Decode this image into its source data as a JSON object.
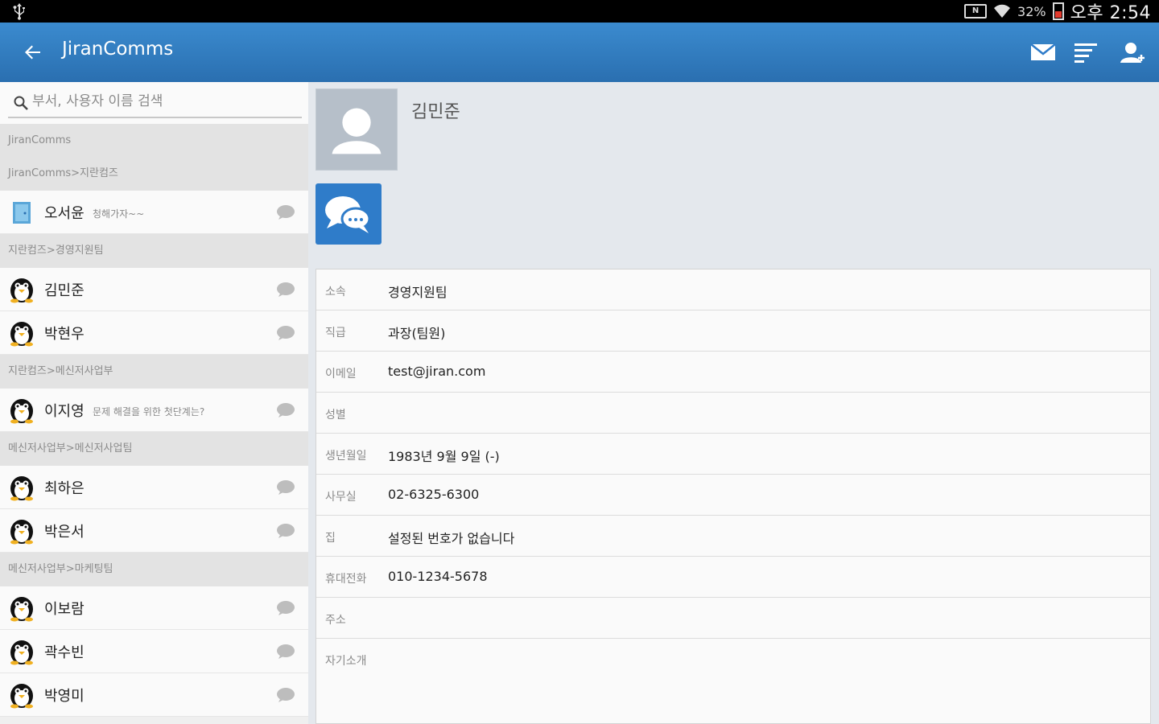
{
  "status_bar": {
    "battery": "32%",
    "time": "오후 2:54"
  },
  "app_bar": {
    "title": "JiranComms"
  },
  "search": {
    "placeholder": "부서, 사용자 이름 검색"
  },
  "sidebar": {
    "headers": [
      "JiranComms",
      "JiranComms>지란컴즈",
      "지란컴즈>경영지원팀",
      "지란컴즈>메신저사업부",
      "메신저사업부>메신저사업팀",
      "메신저사업부>마케팅팀"
    ],
    "contacts": [
      {
        "name": "오서윤",
        "status": "청해가자~~"
      },
      {
        "name": "김민준",
        "status": ""
      },
      {
        "name": "박현우",
        "status": ""
      },
      {
        "name": "이지영",
        "status": "문제 해결을 위한 첫단계는?"
      },
      {
        "name": "최하은",
        "status": ""
      },
      {
        "name": "박은서",
        "status": ""
      },
      {
        "name": "이보람",
        "status": ""
      },
      {
        "name": "곽수빈",
        "status": ""
      },
      {
        "name": "박영미",
        "status": ""
      }
    ]
  },
  "detail": {
    "name": "김민준",
    "fields": [
      {
        "label": "소속",
        "value": "경영지원팀"
      },
      {
        "label": "직급",
        "value": "과장(팀원)"
      },
      {
        "label": "이메일",
        "value": "test@jiran.com"
      },
      {
        "label": "성별",
        "value": ""
      },
      {
        "label": "생년월일",
        "value": "1983년 9월 9일 (-)"
      },
      {
        "label": "사무실",
        "value": "02-6325-6300"
      },
      {
        "label": "집",
        "value": "설정된 번호가 없습니다"
      },
      {
        "label": "휴대전화",
        "value": "010-1234-5678"
      },
      {
        "label": "주소",
        "value": ""
      },
      {
        "label": "자기소개",
        "value": ""
      }
    ]
  },
  "colors": {
    "appbar": "#2f7cc9",
    "status_bar": "#000000",
    "accent_button": "#2f7cc9"
  },
  "icons": [
    "usb-icon",
    "nfc-icon",
    "wifi-icon",
    "battery-icon",
    "back-arrow-icon",
    "mail-icon",
    "list-icon",
    "user-icon",
    "search-icon",
    "door-icon",
    "penguin-avatar-icon",
    "chat-bubble-icon",
    "default-person-icon",
    "messenger-icon"
  ]
}
